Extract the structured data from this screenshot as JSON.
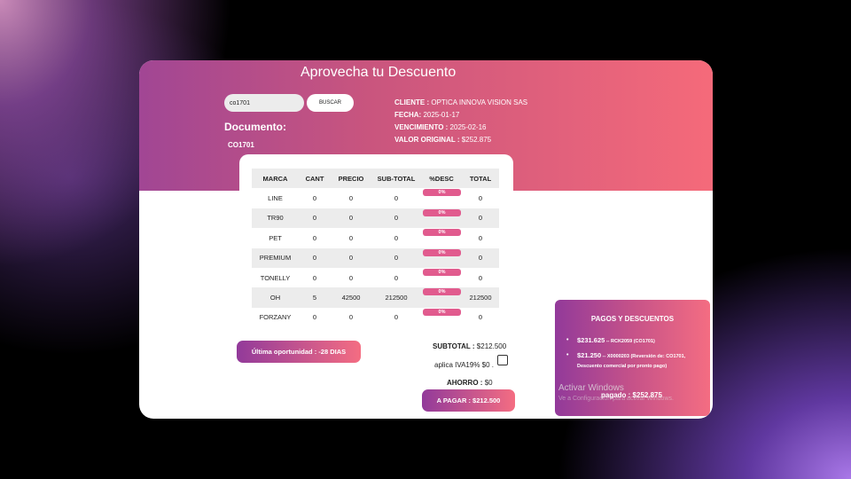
{
  "header": {
    "title": "Aprovecha tu Descuento",
    "search_value": "co1701",
    "search_button": "BUSCAR",
    "document_label": "Documento:",
    "document_value": "CO1701"
  },
  "info": {
    "cliente_label": "CLIENTE :",
    "cliente_value": "OPTICA INNOVA VISION SAS",
    "fecha_label": "FECHA:",
    "fecha_value": "2025-01-17",
    "vencimiento_label": "VENCIMIENTO :",
    "vencimiento_value": "2025-02-16",
    "valor_label": "VALOR ORIGINAL :",
    "valor_value": "$252.875"
  },
  "table": {
    "headers": [
      "MARCA",
      "CANT",
      "PRECIO",
      "SUB-TOTAL",
      "%DESC",
      "TOTAL"
    ],
    "rows": [
      {
        "marca": "LINE",
        "cant": "0",
        "precio": "0",
        "subtotal": "0",
        "desc": "0%",
        "total": "0"
      },
      {
        "marca": "TR90",
        "cant": "0",
        "precio": "0",
        "subtotal": "0",
        "desc": "0%",
        "total": "0"
      },
      {
        "marca": "PET",
        "cant": "0",
        "precio": "0",
        "subtotal": "0",
        "desc": "0%",
        "total": "0"
      },
      {
        "marca": "PREMIUM",
        "cant": "0",
        "precio": "0",
        "subtotal": "0",
        "desc": "0%",
        "total": "0"
      },
      {
        "marca": "TONELLY",
        "cant": "0",
        "precio": "0",
        "subtotal": "0",
        "desc": "0%",
        "total": "0"
      },
      {
        "marca": "OH",
        "cant": "5",
        "precio": "42500",
        "subtotal": "212500",
        "desc": "0%",
        "total": "212500"
      },
      {
        "marca": "FORZANY",
        "cant": "0",
        "precio": "0",
        "subtotal": "0",
        "desc": "0%",
        "total": "0"
      }
    ]
  },
  "summary": {
    "last_chance": "Última oportunidad : -28 DIAS",
    "subtotal_label": "SUBTOTAL :",
    "subtotal_value": "$212.500",
    "iva_text": "aplica IVA19% $0 .",
    "iva_checked": false,
    "ahorro_label": "AHORRO :",
    "ahorro_value": "$0",
    "pay_button": "A PAGAR : $212.500"
  },
  "pagos": {
    "title": "PAGOS Y DESCUENTOS",
    "items": [
      {
        "amount": "$231.625",
        "detail": "-- RCK2059 (CO1701)"
      },
      {
        "amount": "$21.250",
        "detail": "-- X0000203 (Reversión de: CO1701, Descuento comercial por pronto pago)"
      }
    ],
    "pagado": "pagado : $252.875"
  },
  "watermark": {
    "title": "Activar Windows",
    "subtitle": "Ve a Configuración para activar Windows."
  },
  "colors": {
    "gradient_start": "#a14694",
    "gradient_end": "#f56a7a",
    "pill": "#e15b8e"
  }
}
